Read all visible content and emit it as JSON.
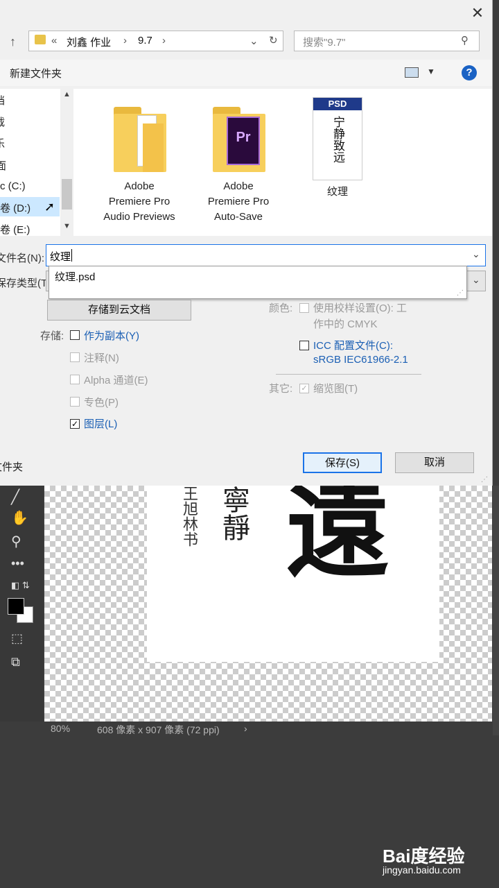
{
  "dialog": {
    "close_glyph": "✕",
    "address": {
      "prefix": "«",
      "segments": [
        "刘鑫 作业",
        "9.7"
      ]
    },
    "search": {
      "placeholder": "搜索\"9.7\""
    },
    "new_folder": "新建文件夹",
    "nav_items": [
      "档",
      "载",
      "乐",
      "面",
      "c (C:)",
      "卷 (D:)",
      "卷 (E:)"
    ],
    "files": [
      {
        "name_lines": [
          "Adobe",
          "Premiere Pro",
          "Audio Previews"
        ],
        "icon": "folder-icon"
      },
      {
        "name_lines": [
          "Adobe",
          "Premiere Pro",
          "Auto-Save"
        ],
        "icon": "premiere-folder-icon"
      },
      {
        "name_lines": [
          "纹理"
        ],
        "icon": "psd-file-icon",
        "badge": "PSD",
        "thumb_text": "宁静致远"
      }
    ],
    "filename": {
      "label": "文件名(N):",
      "value": "纹理",
      "suggestion": "纹理.psd"
    },
    "filetype": {
      "label": "保存类型(T):"
    },
    "cloud_button": "存储到云文档",
    "save_options": {
      "label": "存储:",
      "as_copy": "作为副本(Y)",
      "notes": "注释(N)",
      "alpha": "Alpha 通道(E)",
      "spot": "专色(P)",
      "layers": "图层(L)"
    },
    "color": {
      "label": "颜色:",
      "proof_line1": "使用校样设置(O): 工",
      "proof_line2": "作中的 CMYK",
      "icc_line1": "ICC 配置文件(C):",
      "icc_line2": "sRGB IEC61966-2.1"
    },
    "other": {
      "label": "其它:",
      "thumbnail": "缩览图(T)"
    },
    "hide_folders": "文件夹",
    "save_button": "保存(S)",
    "cancel_button": "取消"
  },
  "status": {
    "zoom": "80%",
    "dimensions": "608 像素 x 907 像素 (72 ppi)",
    "arrow": "›"
  },
  "calligraphy": {
    "big": "遠",
    "mid": "寧靜",
    "small": "王旭林书"
  },
  "watermark": {
    "brand": "Bai度经验",
    "url": "jingyan.baidu.com"
  }
}
